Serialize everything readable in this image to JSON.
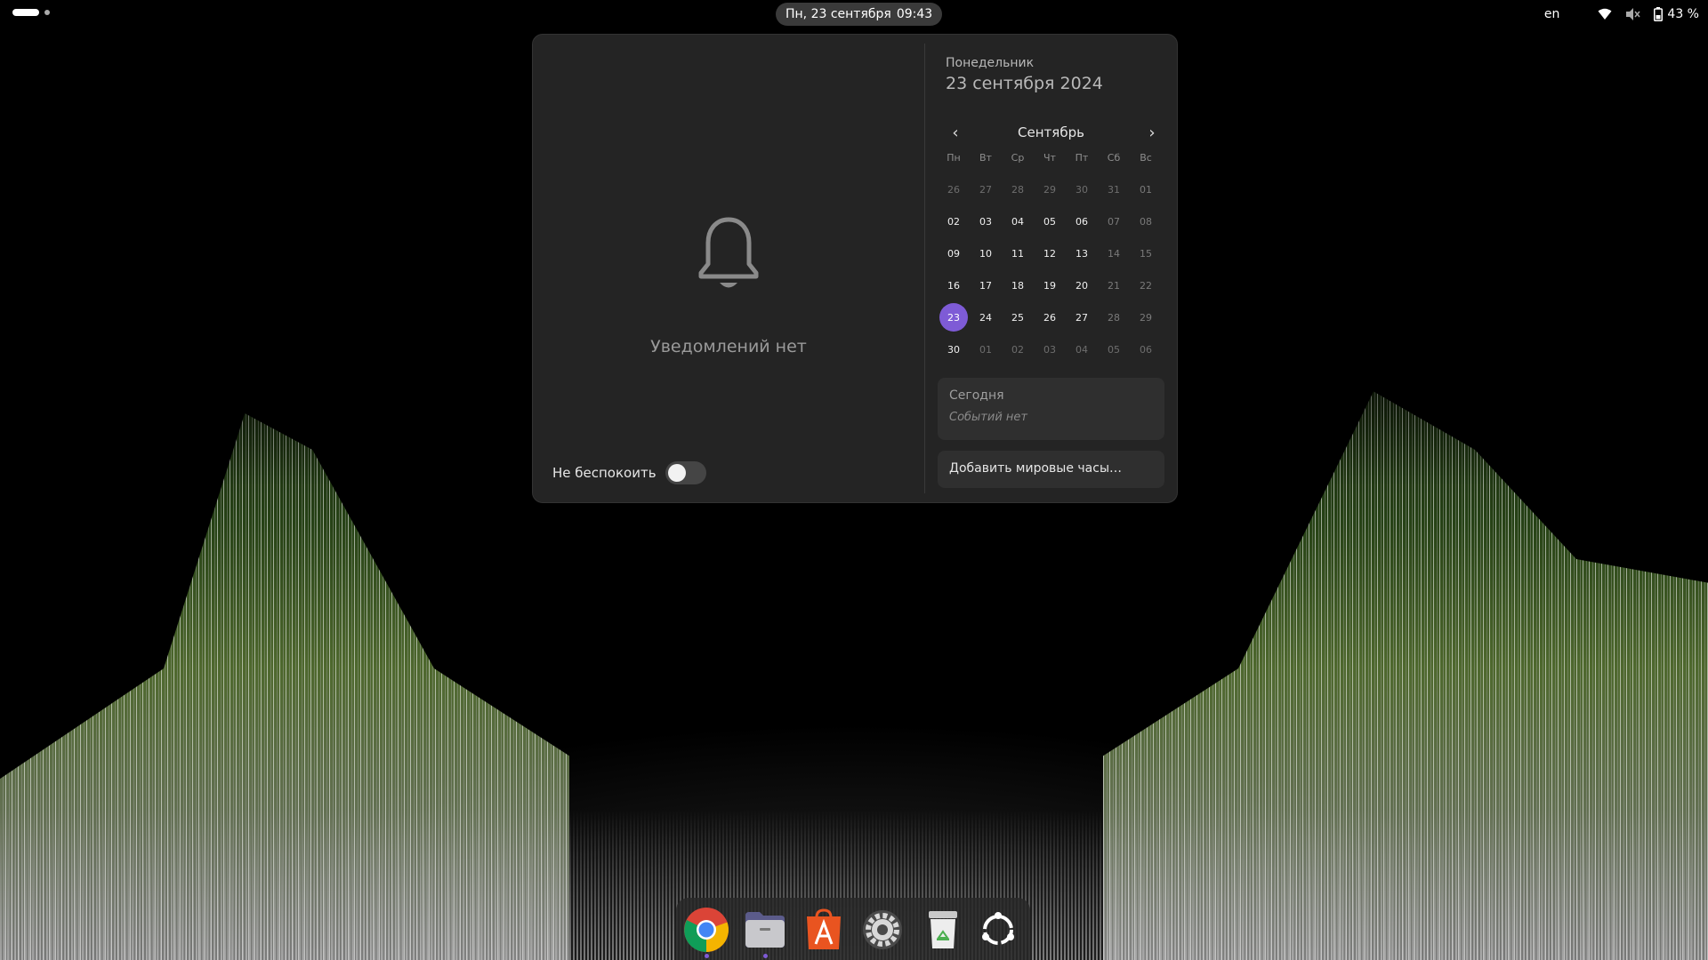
{
  "topbar": {
    "activities_label": "activities",
    "clock_date": "Пн, 23 сентября",
    "clock_time": "09:43",
    "keyboard_layout": "en",
    "battery_percent": "43 %",
    "icons": [
      "wifi-icon",
      "volume-muted-icon",
      "battery-icon"
    ]
  },
  "notifications": {
    "empty_text": "Уведомлений нет",
    "dnd_label": "Не беспокоить",
    "dnd_enabled": false
  },
  "calendar": {
    "day_name": "Понедельник",
    "full_date": "23 сентября 2024",
    "month": "Сентябрь",
    "weekdays": [
      "Пн",
      "Вт",
      "Ср",
      "Чт",
      "Пт",
      "Сб",
      "Вс"
    ],
    "weeks": [
      [
        "26",
        "27",
        "28",
        "29",
        "30",
        "31",
        "01"
      ],
      [
        "02",
        "03",
        "04",
        "05",
        "06",
        "07",
        "08"
      ],
      [
        "09",
        "10",
        "11",
        "12",
        "13",
        "14",
        "15"
      ],
      [
        "16",
        "17",
        "18",
        "19",
        "20",
        "21",
        "22"
      ],
      [
        "23",
        "24",
        "25",
        "26",
        "27",
        "28",
        "29"
      ],
      [
        "30",
        "01",
        "02",
        "03",
        "04",
        "05",
        "06"
      ]
    ],
    "today": "23",
    "events_title": "Сегодня",
    "events_empty": "Событий нет",
    "world_clocks_label": "Добавить мировые часы…"
  },
  "dock": {
    "apps": [
      {
        "name": "chrome-icon",
        "running": true
      },
      {
        "name": "files-icon",
        "running": true
      },
      {
        "name": "app-center-icon",
        "running": false
      },
      {
        "name": "settings-icon",
        "running": false
      },
      {
        "name": "trash-icon",
        "running": false
      },
      {
        "name": "show-apps-icon",
        "running": false
      }
    ]
  },
  "colors": {
    "accent": "#7e5bd6",
    "panel": "#242424",
    "running_dot": "#7e5bd6"
  }
}
